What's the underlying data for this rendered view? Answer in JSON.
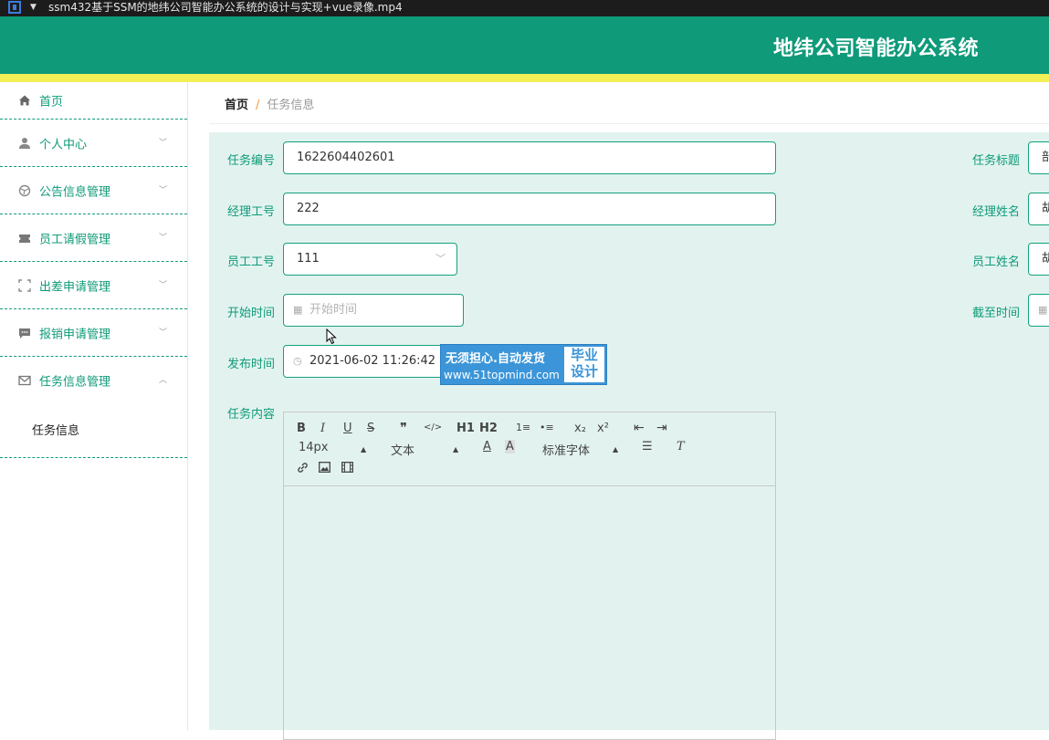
{
  "window": {
    "title": "ssm432基于SSM的地纬公司智能办公系统的设计与实现+vue录像.mp4"
  },
  "header": {
    "brand": "地纬公司智能办公系统"
  },
  "sidebar": {
    "items": [
      {
        "label": "首页",
        "icon": "home-icon"
      },
      {
        "label": "个人中心",
        "icon": "user-icon"
      },
      {
        "label": "公告信息管理",
        "icon": "globe-icon"
      },
      {
        "label": "员工请假管理",
        "icon": "ticket-icon"
      },
      {
        "label": "出差申请管理",
        "icon": "fullscreen-icon"
      },
      {
        "label": "报销申请管理",
        "icon": "chat-icon"
      },
      {
        "label": "任务信息管理",
        "icon": "mail-icon"
      }
    ],
    "submenu": {
      "label": "任务信息"
    }
  },
  "breadcrumb": {
    "home": "首页",
    "separator": "/",
    "current": "任务信息"
  },
  "form": {
    "task_no": {
      "label": "任务编号",
      "value": "1622604402601"
    },
    "task_title": {
      "label": "任务标题",
      "value": "部"
    },
    "manager_id": {
      "label": "经理工号",
      "value": "222"
    },
    "manager_name": {
      "label": "经理姓名",
      "value": "胡"
    },
    "employee_id": {
      "label": "员工工号",
      "value": "111"
    },
    "employee_name": {
      "label": "员工姓名",
      "value": "胡"
    },
    "start_time": {
      "label": "开始时间",
      "placeholder": "开始时间"
    },
    "deadline": {
      "label": "截至时间"
    },
    "publish_time": {
      "label": "发布时间",
      "value": "2021-06-02 11:26:42"
    },
    "content": {
      "label": "任务内容"
    }
  },
  "editor": {
    "font_size": "14px",
    "header_select": "文本",
    "font_family": "标准字体",
    "buttons": [
      "B",
      "I",
      "U",
      "S",
      "❞",
      "</>",
      "H1",
      "H2",
      "1≡",
      "•≡",
      "x₂",
      "x²",
      "⇤",
      "⇥"
    ]
  },
  "watermark": {
    "main": "无须担心.自动发货",
    "url": "www.51topmind.com",
    "box_line1": "毕业",
    "box_line2": "设计"
  },
  "colors": {
    "primary": "#0f9a79",
    "accent_strip": "#f2ef57",
    "form_bg": "#e2f3ef"
  }
}
